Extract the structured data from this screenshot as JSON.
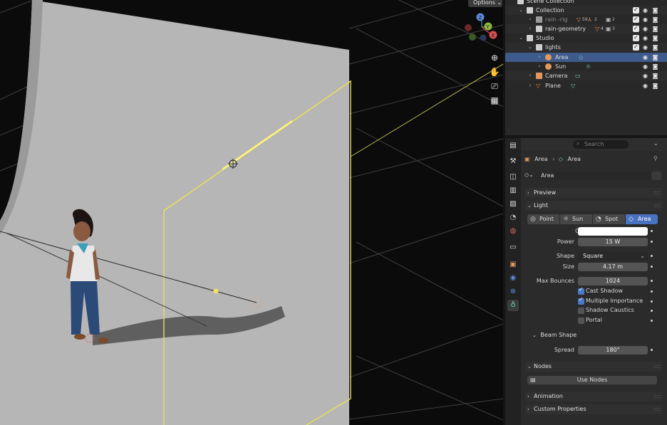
{
  "viewport": {
    "options_label": "Options",
    "gizmo": {
      "z": "Z",
      "y": "Y",
      "x": "X"
    }
  },
  "outliner": {
    "rows": [
      {
        "label": "Scene Collection"
      },
      {
        "label": "Collection"
      },
      {
        "label": "rain -rig",
        "count_a": "59",
        "count_b": "2",
        "count_c": "2"
      },
      {
        "label": "rain-geometry",
        "count_a": "4",
        "count_b": "3"
      },
      {
        "label": "Studio"
      },
      {
        "label": "lights"
      },
      {
        "label": "Area"
      },
      {
        "label": "Sun"
      },
      {
        "label": "Camera"
      },
      {
        "label": "Plane"
      }
    ]
  },
  "properties": {
    "search_placeholder": "Search",
    "breadcrumb": {
      "object": "Area",
      "data": "Area"
    },
    "datablock_name": "Area",
    "panels": {
      "preview": "Preview",
      "light": "Light",
      "beam_shape": "Beam Shape",
      "nodes": "Nodes",
      "animation": "Animation",
      "custom_properties": "Custom Properties"
    },
    "light_types": [
      "Point",
      "Sun",
      "Spot",
      "Area"
    ],
    "fields": {
      "color_label": "Color",
      "power_label": "Power",
      "power_value": "15 W",
      "shape_label": "Shape",
      "shape_value": "Square",
      "size_label": "Size",
      "size_value": "4.17 m",
      "max_bounces_label": "Max Bounces",
      "max_bounces_value": "1024",
      "spread_label": "Spread",
      "spread_value": "180°"
    },
    "checkboxes": [
      {
        "label": "Cast Shadow",
        "checked": true
      },
      {
        "label": "Multiple Importance",
        "checked": true
      },
      {
        "label": "Shadow Caustics",
        "checked": false
      },
      {
        "label": "Portal",
        "checked": false
      }
    ],
    "use_nodes_label": "Use Nodes"
  },
  "colors": {
    "selection": "#3f5b8b",
    "accent": "#4a72c0",
    "light_outline": "#e6e05a"
  }
}
